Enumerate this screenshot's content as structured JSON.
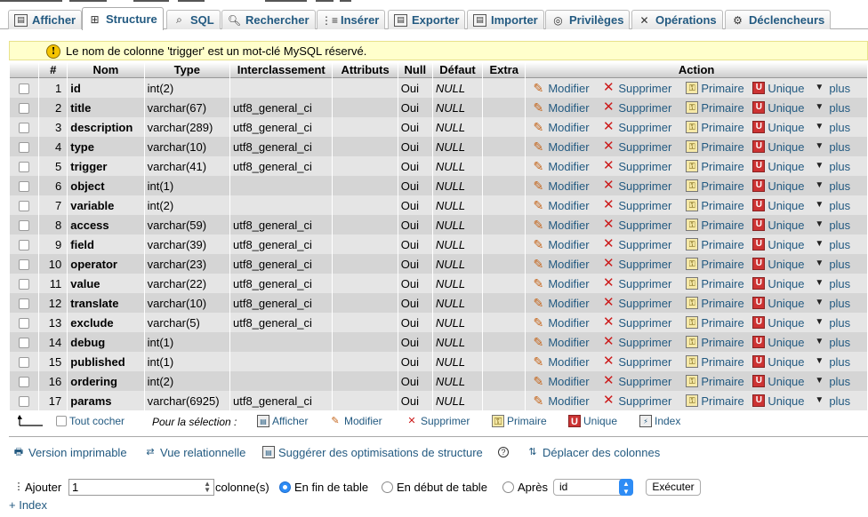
{
  "tabs": [
    {
      "label": "Afficher",
      "icon": "table-browse-icon"
    },
    {
      "label": "Structure",
      "icon": "structure-icon"
    },
    {
      "label": "SQL",
      "icon": "sql-icon"
    },
    {
      "label": "Rechercher",
      "icon": "search-icon"
    },
    {
      "label": "Insérer",
      "icon": "insert-icon"
    },
    {
      "label": "Exporter",
      "icon": "export-icon"
    },
    {
      "label": "Importer",
      "icon": "import-icon"
    },
    {
      "label": "Privilèges",
      "icon": "privileges-icon"
    },
    {
      "label": "Opérations",
      "icon": "operations-icon"
    },
    {
      "label": "Déclencheurs",
      "icon": "triggers-icon"
    }
  ],
  "notice": "Le nom de colonne 'trigger' est un mot-clé MySQL réservé.",
  "headers": {
    "num": "#",
    "name": "Nom",
    "type": "Type",
    "collation": "Interclassement",
    "attributes": "Attributs",
    "null": "Null",
    "default": "Défaut",
    "extra": "Extra",
    "action": "Action"
  },
  "actions": {
    "modify": "Modifier",
    "drop": "Supprimer",
    "primary": "Primaire",
    "unique": "Unique",
    "more": "plus"
  },
  "columns": [
    {
      "num": "1",
      "name": "id",
      "type": "int(2)",
      "collation": "",
      "null": "Oui",
      "default": "NULL"
    },
    {
      "num": "2",
      "name": "title",
      "type": "varchar(67)",
      "collation": "utf8_general_ci",
      "null": "Oui",
      "default": "NULL"
    },
    {
      "num": "3",
      "name": "description",
      "type": "varchar(289)",
      "collation": "utf8_general_ci",
      "null": "Oui",
      "default": "NULL"
    },
    {
      "num": "4",
      "name": "type",
      "type": "varchar(10)",
      "collation": "utf8_general_ci",
      "null": "Oui",
      "default": "NULL"
    },
    {
      "num": "5",
      "name": "trigger",
      "type": "varchar(41)",
      "collation": "utf8_general_ci",
      "null": "Oui",
      "default": "NULL"
    },
    {
      "num": "6",
      "name": "object",
      "type": "int(1)",
      "collation": "",
      "null": "Oui",
      "default": "NULL"
    },
    {
      "num": "7",
      "name": "variable",
      "type": "int(2)",
      "collation": "",
      "null": "Oui",
      "default": "NULL"
    },
    {
      "num": "8",
      "name": "access",
      "type": "varchar(59)",
      "collation": "utf8_general_ci",
      "null": "Oui",
      "default": "NULL"
    },
    {
      "num": "9",
      "name": "field",
      "type": "varchar(39)",
      "collation": "utf8_general_ci",
      "null": "Oui",
      "default": "NULL"
    },
    {
      "num": "10",
      "name": "operator",
      "type": "varchar(23)",
      "collation": "utf8_general_ci",
      "null": "Oui",
      "default": "NULL"
    },
    {
      "num": "11",
      "name": "value",
      "type": "varchar(22)",
      "collation": "utf8_general_ci",
      "null": "Oui",
      "default": "NULL"
    },
    {
      "num": "12",
      "name": "translate",
      "type": "varchar(10)",
      "collation": "utf8_general_ci",
      "null": "Oui",
      "default": "NULL"
    },
    {
      "num": "13",
      "name": "exclude",
      "type": "varchar(5)",
      "collation": "utf8_general_ci",
      "null": "Oui",
      "default": "NULL"
    },
    {
      "num": "14",
      "name": "debug",
      "type": "int(1)",
      "collation": "",
      "null": "Oui",
      "default": "NULL"
    },
    {
      "num": "15",
      "name": "published",
      "type": "int(1)",
      "collation": "",
      "null": "Oui",
      "default": "NULL"
    },
    {
      "num": "16",
      "name": "ordering",
      "type": "int(2)",
      "collation": "",
      "null": "Oui",
      "default": "NULL"
    },
    {
      "num": "17",
      "name": "params",
      "type": "varchar(6925)",
      "collation": "utf8_general_ci",
      "null": "Oui",
      "default": "NULL"
    }
  ],
  "selection": {
    "check_all": "Tout cocher",
    "label": "Pour la sélection :",
    "browse": "Afficher",
    "modify": "Modifier",
    "drop": "Supprimer",
    "primary": "Primaire",
    "unique": "Unique",
    "index": "Index"
  },
  "links": {
    "print": "Version imprimable",
    "relational": "Vue relationnelle",
    "propose": "Suggérer des optimisations de structure",
    "move": "Déplacer des colonnes"
  },
  "add": {
    "label": "Ajouter",
    "count": "1",
    "columns_label": "colonne(s)",
    "at_end": "En fin de table",
    "at_start": "En début de table",
    "after": "Après",
    "after_column": "id",
    "execute": "Exécuter",
    "index_link": "+ Index"
  },
  "colors": {
    "link": "#235a81",
    "row_light": "#e5e5e5",
    "row_dark": "#d5d5d5",
    "notice_bg": "#ffffcc"
  }
}
